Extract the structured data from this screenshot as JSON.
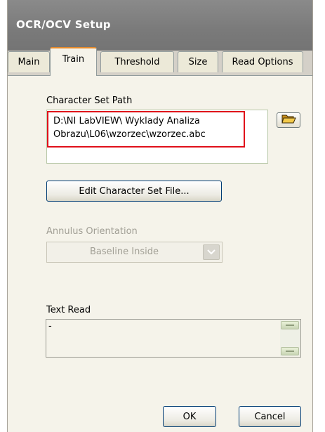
{
  "window": {
    "title": "OCR/OCV Setup"
  },
  "tabs": [
    {
      "label": "Main",
      "active": false
    },
    {
      "label": "Train",
      "active": true
    },
    {
      "label": "Threshold",
      "active": false
    },
    {
      "label": "Size",
      "active": false
    },
    {
      "label": "Read Options",
      "active": false
    }
  ],
  "train": {
    "charset_path_label": "Character Set Path",
    "charset_path_line1": "D:\\NI LabVIEW\\ Wyklady Analiza",
    "charset_path_line2": "Obrazu\\L06\\wzorzec\\wzorzec.abc",
    "browse_icon": "folder-open-icon",
    "edit_charset_button": "Edit Character Set File...",
    "annulus_label": "Annulus Orientation",
    "annulus_value": "Baseline Inside",
    "text_read_label": "Text Read",
    "text_read_value": "-"
  },
  "footer": {
    "ok_label": "OK",
    "cancel_label": "Cancel"
  },
  "colors": {
    "titlebar": "#7a7a7a",
    "panel": "#f5f3ea",
    "highlight": "#e0101a",
    "active_tab_accent": "#e68b2c",
    "disabled_text": "#a19f95"
  }
}
